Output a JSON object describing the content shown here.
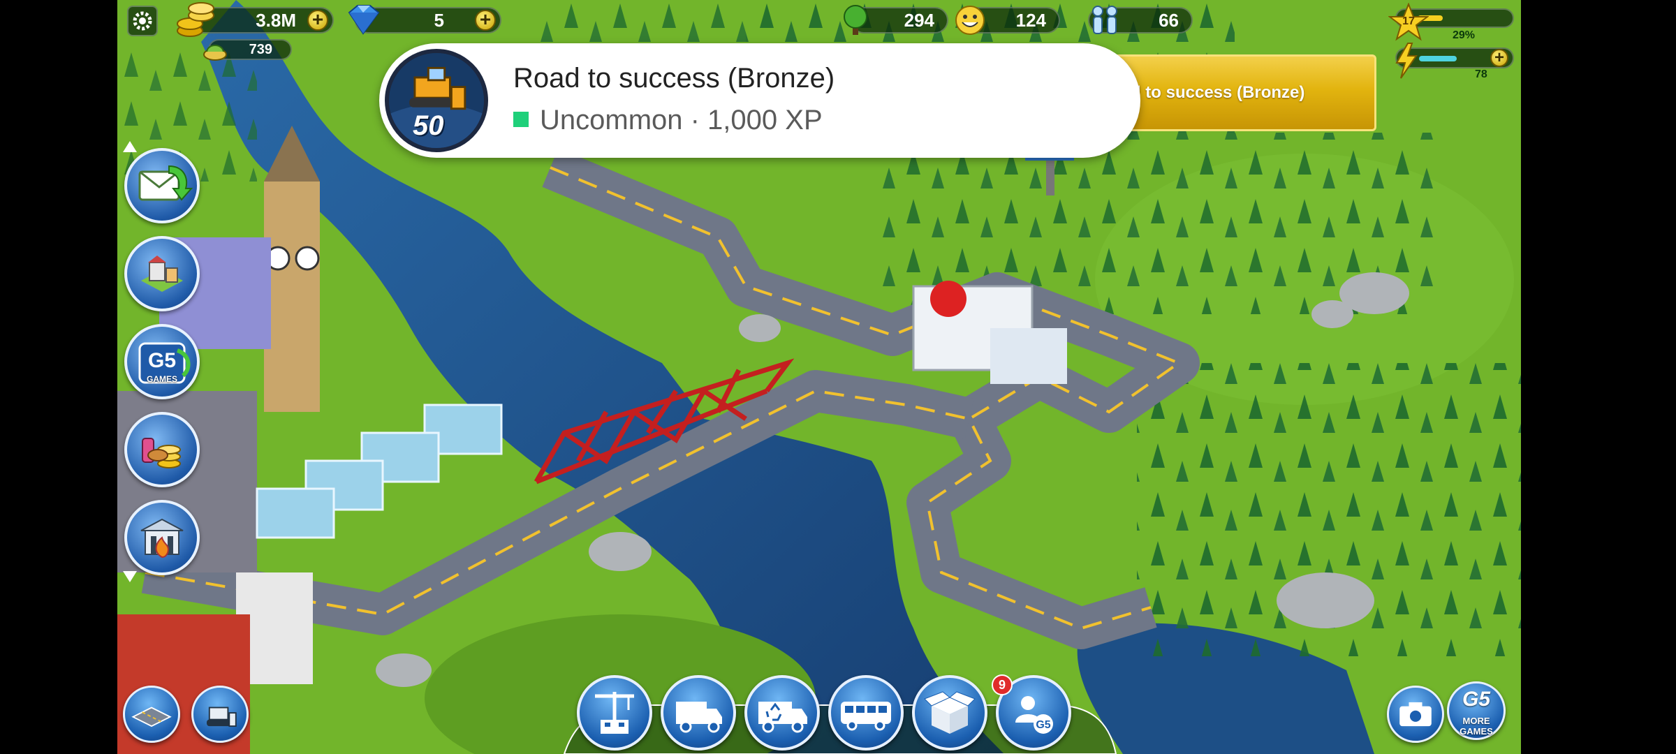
{
  "hud": {
    "coins": "3.8M",
    "gems": "5",
    "food": "739",
    "eco": "294",
    "happiness": "124",
    "population": "66",
    "level": "17",
    "xp_percent": "29%",
    "xp_fraction": 0.29,
    "energy": "78",
    "energy_fraction": 0.6
  },
  "toast": {
    "badge_number": "50",
    "title": "Road to success (Bronze)",
    "subtitle": "Uncommon · 1,000 XP",
    "rarity_color": "#1fd07a"
  },
  "banner": {
    "label": "Road to success (Bronze)"
  },
  "side_buttons": [
    "mail-icon",
    "city-icon",
    "g5-games-icon",
    "shop-icon",
    "fire-station-icon"
  ],
  "bottom_buttons": [
    "construction-icon",
    "truck-icon",
    "recycling-truck-icon",
    "bus-icon",
    "box-icon",
    "friends-icon"
  ],
  "social_badge": "9",
  "g5_side_label": "GAMES",
  "more_games": {
    "logo": "G5",
    "label": "MORE GAMES"
  },
  "colors": {
    "accent_gold": "#e2b40f",
    "button_blue": "#1b5fb0",
    "grass": "#6fb22a",
    "water": "#1e4f86"
  }
}
